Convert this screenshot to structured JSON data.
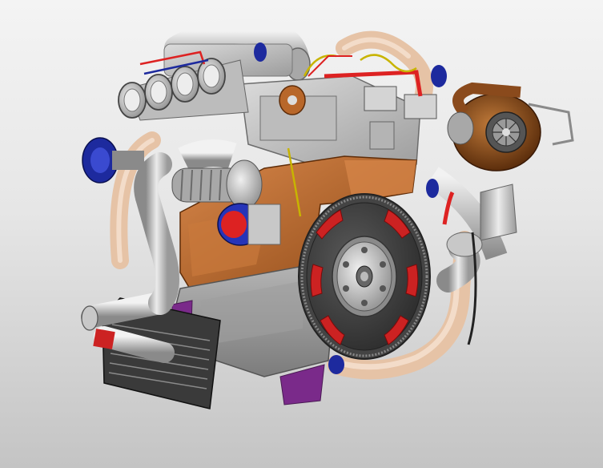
{
  "viewport": {
    "background_top": "#f4f4f4",
    "background_bottom": "#c4c4c4"
  },
  "model": {
    "subject": "turbocharged-inline-four-engine-cad-model",
    "colors": {
      "block": "#b8672a",
      "head": "#c8c8c8",
      "pipes": "#d8d8d8",
      "turbo_housing": "#8a4a1c",
      "flywheel_ring": "#cc2222",
      "blowoff_valve": "#1d2a9e",
      "oil_pan_bracket": "#7a2a8a",
      "coolant_pipe": "#e6c3a6",
      "wiring": "#c8b400"
    },
    "icons": [
      "flywheel-icon",
      "turbocharger-icon",
      "throttle-body-icon",
      "intercooler-icon"
    ]
  }
}
